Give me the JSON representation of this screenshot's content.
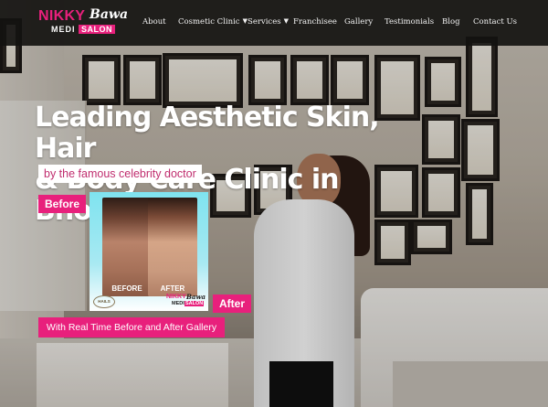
{
  "brand": {
    "logo_top_1": "NIKKY",
    "logo_top_2": "Bawa",
    "logo_bottom_1": "MEDI",
    "logo_bottom_2": "SALON",
    "accent_color": "#e8207c"
  },
  "nav": {
    "items": [
      {
        "label": "About"
      },
      {
        "label": "Cosmetic Clinic",
        "has_dropdown": true
      },
      {
        "label": "Services",
        "has_dropdown": true
      },
      {
        "label": "Franchisee"
      },
      {
        "label": "Gallery"
      },
      {
        "label": "Testimonials"
      },
      {
        "label": "Blog"
      },
      {
        "label": "Contact Us"
      }
    ],
    "chevron_icon": "chevron-down-icon"
  },
  "hero": {
    "headline_line1": "Leading Aesthetic Skin, Hair",
    "headline_line2": "& Body Care Clinic in Bhopal",
    "byline": "by the famous celebrity doctor",
    "before_tag": "Before",
    "after_tag": "After",
    "card": {
      "before_label": "BEFORE",
      "after_label": "AFTER",
      "badge": "HAILS"
    },
    "cta": "With Real Time Before and After Gallery"
  }
}
